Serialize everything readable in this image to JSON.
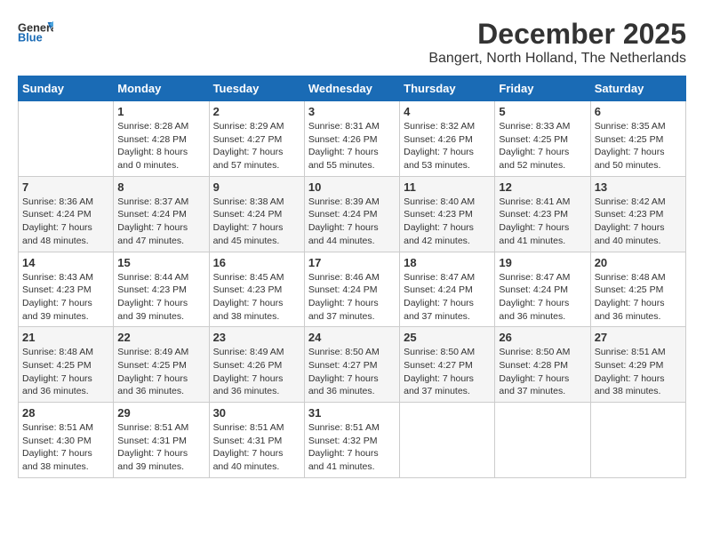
{
  "header": {
    "logo_general": "General",
    "logo_blue": "Blue",
    "month_title": "December 2025",
    "location": "Bangert, North Holland, The Netherlands"
  },
  "days_of_week": [
    "Sunday",
    "Monday",
    "Tuesday",
    "Wednesday",
    "Thursday",
    "Friday",
    "Saturday"
  ],
  "weeks": [
    [
      {
        "day": "",
        "sunrise": "",
        "sunset": "",
        "daylight": ""
      },
      {
        "day": "1",
        "sunrise": "Sunrise: 8:28 AM",
        "sunset": "Sunset: 4:28 PM",
        "daylight": "Daylight: 8 hours and 0 minutes."
      },
      {
        "day": "2",
        "sunrise": "Sunrise: 8:29 AM",
        "sunset": "Sunset: 4:27 PM",
        "daylight": "Daylight: 7 hours and 57 minutes."
      },
      {
        "day": "3",
        "sunrise": "Sunrise: 8:31 AM",
        "sunset": "Sunset: 4:26 PM",
        "daylight": "Daylight: 7 hours and 55 minutes."
      },
      {
        "day": "4",
        "sunrise": "Sunrise: 8:32 AM",
        "sunset": "Sunset: 4:26 PM",
        "daylight": "Daylight: 7 hours and 53 minutes."
      },
      {
        "day": "5",
        "sunrise": "Sunrise: 8:33 AM",
        "sunset": "Sunset: 4:25 PM",
        "daylight": "Daylight: 7 hours and 52 minutes."
      },
      {
        "day": "6",
        "sunrise": "Sunrise: 8:35 AM",
        "sunset": "Sunset: 4:25 PM",
        "daylight": "Daylight: 7 hours and 50 minutes."
      }
    ],
    [
      {
        "day": "7",
        "sunrise": "Sunrise: 8:36 AM",
        "sunset": "Sunset: 4:24 PM",
        "daylight": "Daylight: 7 hours and 48 minutes."
      },
      {
        "day": "8",
        "sunrise": "Sunrise: 8:37 AM",
        "sunset": "Sunset: 4:24 PM",
        "daylight": "Daylight: 7 hours and 47 minutes."
      },
      {
        "day": "9",
        "sunrise": "Sunrise: 8:38 AM",
        "sunset": "Sunset: 4:24 PM",
        "daylight": "Daylight: 7 hours and 45 minutes."
      },
      {
        "day": "10",
        "sunrise": "Sunrise: 8:39 AM",
        "sunset": "Sunset: 4:24 PM",
        "daylight": "Daylight: 7 hours and 44 minutes."
      },
      {
        "day": "11",
        "sunrise": "Sunrise: 8:40 AM",
        "sunset": "Sunset: 4:23 PM",
        "daylight": "Daylight: 7 hours and 42 minutes."
      },
      {
        "day": "12",
        "sunrise": "Sunrise: 8:41 AM",
        "sunset": "Sunset: 4:23 PM",
        "daylight": "Daylight: 7 hours and 41 minutes."
      },
      {
        "day": "13",
        "sunrise": "Sunrise: 8:42 AM",
        "sunset": "Sunset: 4:23 PM",
        "daylight": "Daylight: 7 hours and 40 minutes."
      }
    ],
    [
      {
        "day": "14",
        "sunrise": "Sunrise: 8:43 AM",
        "sunset": "Sunset: 4:23 PM",
        "daylight": "Daylight: 7 hours and 39 minutes."
      },
      {
        "day": "15",
        "sunrise": "Sunrise: 8:44 AM",
        "sunset": "Sunset: 4:23 PM",
        "daylight": "Daylight: 7 hours and 39 minutes."
      },
      {
        "day": "16",
        "sunrise": "Sunrise: 8:45 AM",
        "sunset": "Sunset: 4:23 PM",
        "daylight": "Daylight: 7 hours and 38 minutes."
      },
      {
        "day": "17",
        "sunrise": "Sunrise: 8:46 AM",
        "sunset": "Sunset: 4:24 PM",
        "daylight": "Daylight: 7 hours and 37 minutes."
      },
      {
        "day": "18",
        "sunrise": "Sunrise: 8:47 AM",
        "sunset": "Sunset: 4:24 PM",
        "daylight": "Daylight: 7 hours and 37 minutes."
      },
      {
        "day": "19",
        "sunrise": "Sunrise: 8:47 AM",
        "sunset": "Sunset: 4:24 PM",
        "daylight": "Daylight: 7 hours and 36 minutes."
      },
      {
        "day": "20",
        "sunrise": "Sunrise: 8:48 AM",
        "sunset": "Sunset: 4:25 PM",
        "daylight": "Daylight: 7 hours and 36 minutes."
      }
    ],
    [
      {
        "day": "21",
        "sunrise": "Sunrise: 8:48 AM",
        "sunset": "Sunset: 4:25 PM",
        "daylight": "Daylight: 7 hours and 36 minutes."
      },
      {
        "day": "22",
        "sunrise": "Sunrise: 8:49 AM",
        "sunset": "Sunset: 4:25 PM",
        "daylight": "Daylight: 7 hours and 36 minutes."
      },
      {
        "day": "23",
        "sunrise": "Sunrise: 8:49 AM",
        "sunset": "Sunset: 4:26 PM",
        "daylight": "Daylight: 7 hours and 36 minutes."
      },
      {
        "day": "24",
        "sunrise": "Sunrise: 8:50 AM",
        "sunset": "Sunset: 4:27 PM",
        "daylight": "Daylight: 7 hours and 36 minutes."
      },
      {
        "day": "25",
        "sunrise": "Sunrise: 8:50 AM",
        "sunset": "Sunset: 4:27 PM",
        "daylight": "Daylight: 7 hours and 37 minutes."
      },
      {
        "day": "26",
        "sunrise": "Sunrise: 8:50 AM",
        "sunset": "Sunset: 4:28 PM",
        "daylight": "Daylight: 7 hours and 37 minutes."
      },
      {
        "day": "27",
        "sunrise": "Sunrise: 8:51 AM",
        "sunset": "Sunset: 4:29 PM",
        "daylight": "Daylight: 7 hours and 38 minutes."
      }
    ],
    [
      {
        "day": "28",
        "sunrise": "Sunrise: 8:51 AM",
        "sunset": "Sunset: 4:30 PM",
        "daylight": "Daylight: 7 hours and 38 minutes."
      },
      {
        "day": "29",
        "sunrise": "Sunrise: 8:51 AM",
        "sunset": "Sunset: 4:31 PM",
        "daylight": "Daylight: 7 hours and 39 minutes."
      },
      {
        "day": "30",
        "sunrise": "Sunrise: 8:51 AM",
        "sunset": "Sunset: 4:31 PM",
        "daylight": "Daylight: 7 hours and 40 minutes."
      },
      {
        "day": "31",
        "sunrise": "Sunrise: 8:51 AM",
        "sunset": "Sunset: 4:32 PM",
        "daylight": "Daylight: 7 hours and 41 minutes."
      },
      {
        "day": "",
        "sunrise": "",
        "sunset": "",
        "daylight": ""
      },
      {
        "day": "",
        "sunrise": "",
        "sunset": "",
        "daylight": ""
      },
      {
        "day": "",
        "sunrise": "",
        "sunset": "",
        "daylight": ""
      }
    ]
  ]
}
